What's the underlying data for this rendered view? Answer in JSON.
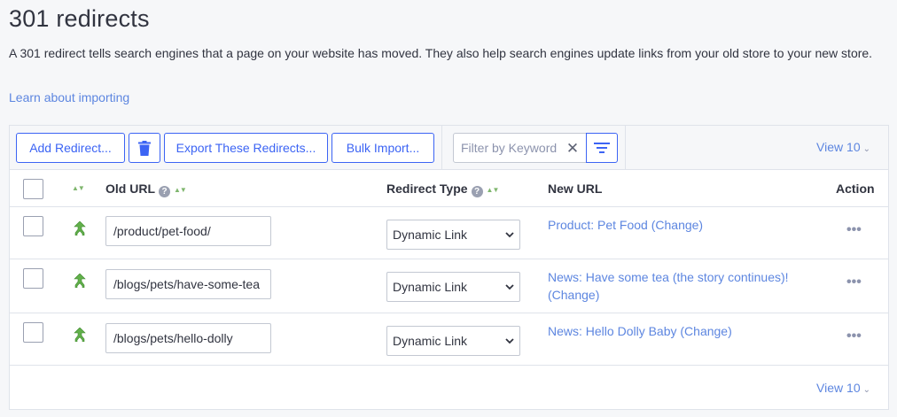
{
  "page": {
    "title": "301 redirects",
    "description": "A 301 redirect tells search engines that a page on your website has moved. They also help search engines update links from your old store to your new store.",
    "learn_link": "Learn about importing"
  },
  "toolbar": {
    "add_label": "Add Redirect...",
    "delete_icon": "trash-icon",
    "export_label": "Export These Redirects...",
    "bulk_import_label": "Bulk Import...",
    "filter_placeholder": "Filter by Keyword",
    "view_label": "View 10"
  },
  "table": {
    "columns": {
      "old_url": "Old URL",
      "redirect_type": "Redirect Type",
      "new_url": "New URL",
      "action": "Action"
    },
    "rows": [
      {
        "old_url": "/product/pet-food/",
        "redirect_type": "Dynamic Link",
        "new_url": "Product: Pet Food (Change)"
      },
      {
        "old_url": "/blogs/pets/have-some-tea",
        "redirect_type": "Dynamic Link",
        "new_url": "News: Have some tea (the story continues)! (Change)"
      },
      {
        "old_url": "/blogs/pets/hello-dolly",
        "redirect_type": "Dynamic Link",
        "new_url": "News: Hello Dolly Baby (Change)"
      }
    ],
    "action_glyph": "•••"
  },
  "footer": {
    "view_label": "View 10"
  },
  "colors": {
    "accent": "#3c64f4",
    "link": "#5d86e0",
    "background": "#f6f7f9",
    "sort_arrow": "#7fb66e"
  }
}
